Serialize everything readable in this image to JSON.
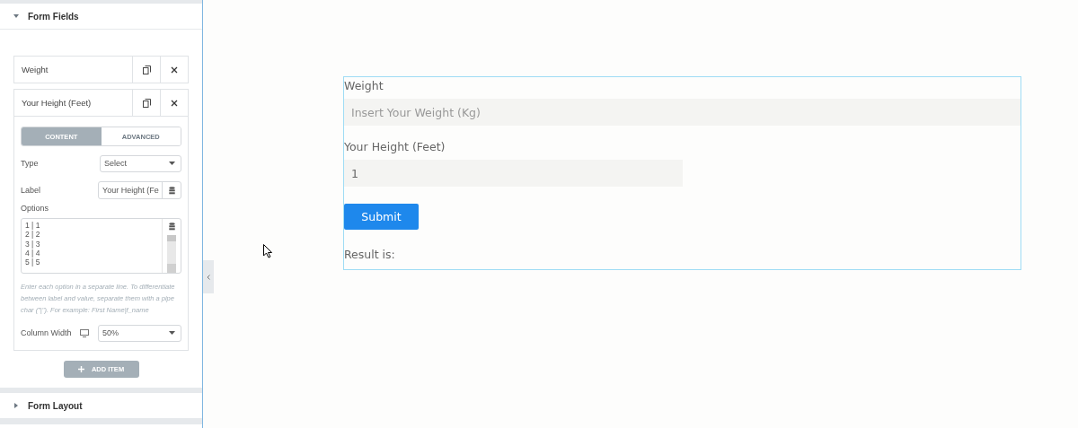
{
  "panel": {
    "sections": [
      {
        "title": "Form Fields",
        "expanded": true
      },
      {
        "title": "Form Layout",
        "expanded": false
      }
    ],
    "items": [
      {
        "label": "Weight",
        "expanded": false
      },
      {
        "label": "Your Height (Feet)",
        "expanded": true
      }
    ],
    "tabs": [
      {
        "label": "CONTENT",
        "selected": true
      },
      {
        "label": "ADVANCED",
        "selected": false
      }
    ],
    "type": {
      "label": "Type",
      "value": "Select"
    },
    "field_label": {
      "label": "Label",
      "value": "Your Height (Fe"
    },
    "options": {
      "label": "Options",
      "lines": [
        "1 | 1",
        "2 | 2",
        "3 | 3",
        "4 | 4",
        "5 | 5"
      ],
      "help": "Enter each option in a separate line. To differentiate between label and value, separate them with a pipe char (\"|\"). For example: First Name|f_name"
    },
    "column_width": {
      "label": "Column Width",
      "value": "50%"
    },
    "add_item": "ADD ITEM"
  },
  "form": {
    "fields": [
      {
        "label": "Weight",
        "placeholder": "Insert Your Weight (Kg)",
        "half": false
      },
      {
        "label": "Your Height (Feet)",
        "value": "1",
        "half": true
      }
    ],
    "submit": "Submit",
    "result": "Result is:"
  }
}
